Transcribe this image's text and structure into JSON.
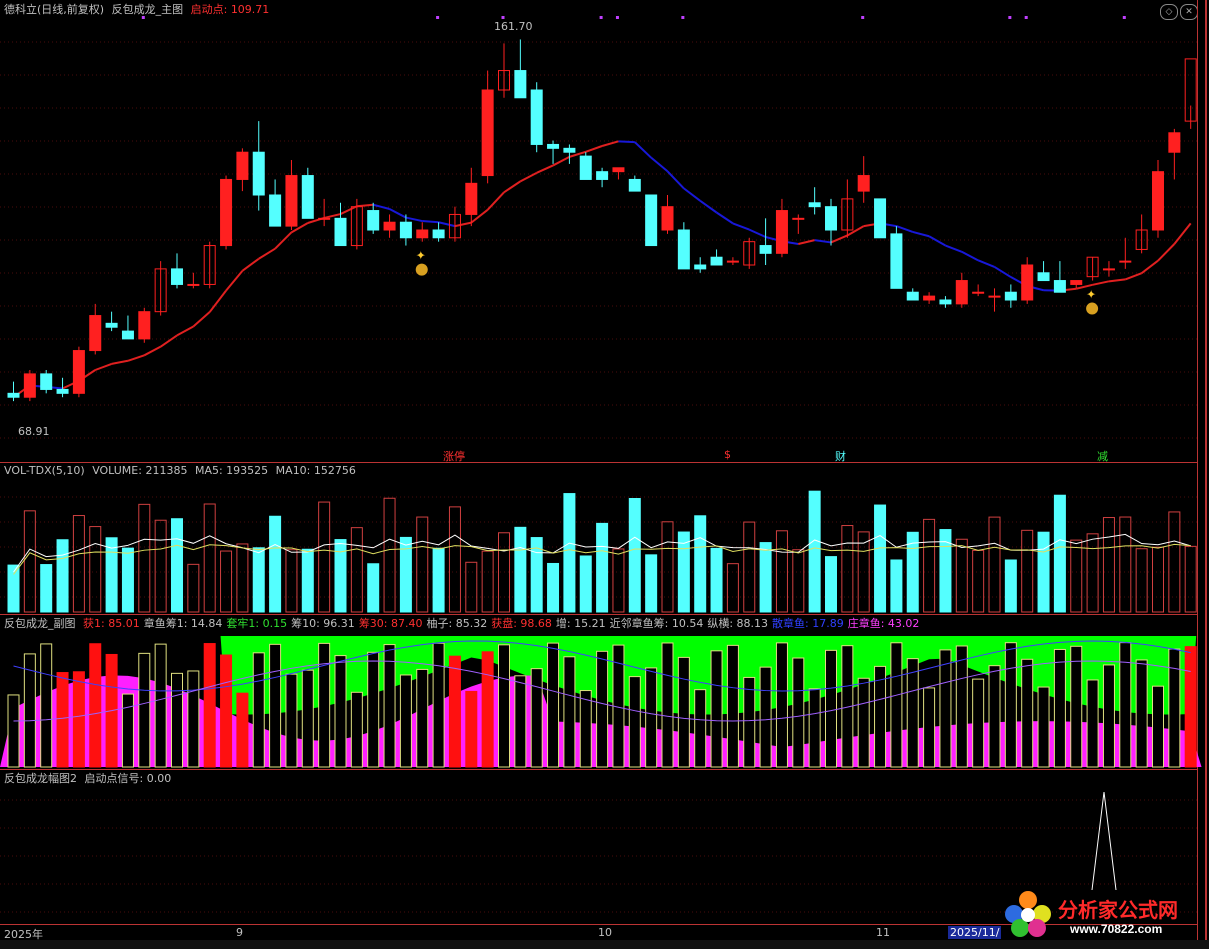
{
  "main": {
    "symbol": "德科立(日线,前复权)",
    "indicator": "反包成龙_主图",
    "start_label": "启动点:",
    "start_value": "109.71",
    "high_label": "161.70",
    "low_label": "68.91",
    "markers": [
      "涨停",
      "$",
      "财",
      "减"
    ]
  },
  "vol": {
    "title": "VOL-TDX(5,10)",
    "volume": "VOLUME: 211385",
    "ma5": "MA5: 193525",
    "ma10": "MA10: 152756"
  },
  "sub": {
    "title": "反包成龙_副图",
    "items": [
      {
        "t": "获1: 85.01",
        "c": "#ff3030"
      },
      {
        "t": "章鱼筹1: 14.84",
        "c": "#c0c0c0"
      },
      {
        "t": "套牢1: 0.15",
        "c": "#30e030"
      },
      {
        "t": "筹10: 96.31",
        "c": "#c0c0c0"
      },
      {
        "t": "筹30: 87.40",
        "c": "#ff3030"
      },
      {
        "t": "柚子: 85.32",
        "c": "#c0c0c0"
      },
      {
        "t": "获盘: 98.68",
        "c": "#ff3030"
      },
      {
        "t": "增: 15.21",
        "c": "#c0c0c0"
      },
      {
        "t": "近邻章鱼筹: 10.54",
        "c": "#c0c0c0"
      },
      {
        "t": "纵横: 88.13",
        "c": "#c0c0c0"
      },
      {
        "t": "散章鱼: 17.89",
        "c": "#3040ff"
      },
      {
        "t": "庄章鱼: 43.02",
        "c": "#ff40ff"
      }
    ]
  },
  "sub2": {
    "title": "反包成龙幅图2",
    "signal": "启动点信号: 0.00"
  },
  "xaxis": [
    "2025年",
    "9",
    "10",
    "11",
    "2025/11/"
  ],
  "logo": {
    "text": "分析家公式网",
    "url": "www.70822.com"
  },
  "colors": {
    "up": "#ff2020",
    "down": "#54ffff",
    "ma_up": "#e02020",
    "ma_down": "#1818d8",
    "frame": "#b33333"
  },
  "chart_data": {
    "type": "candlestick",
    "price_range": [
      68.91,
      161.7
    ],
    "candles": [
      [
        72,
        75,
        70,
        71
      ],
      [
        71,
        78,
        70,
        77
      ],
      [
        77,
        78,
        72,
        73
      ],
      [
        73,
        76,
        71,
        72
      ],
      [
        72,
        84,
        71,
        83
      ],
      [
        83,
        95,
        82,
        92
      ],
      [
        90,
        93,
        88,
        89
      ],
      [
        88,
        92,
        86,
        86
      ],
      [
        86,
        94,
        85,
        93
      ],
      [
        93,
        106,
        92,
        104
      ],
      [
        104,
        108,
        99,
        100
      ],
      [
        100,
        103,
        99,
        100
      ],
      [
        100,
        111,
        99,
        110
      ],
      [
        110,
        128,
        109,
        127
      ],
      [
        127,
        135,
        124,
        134
      ],
      [
        134,
        142,
        119,
        123
      ],
      [
        123,
        127,
        115,
        115
      ],
      [
        115,
        132,
        114,
        128
      ],
      [
        128,
        130,
        118,
        117
      ],
      [
        117,
        122,
        115,
        117
      ],
      [
        117,
        121,
        110,
        110
      ],
      [
        110,
        122,
        109,
        120
      ],
      [
        119,
        121,
        113,
        114
      ],
      [
        114,
        118,
        112,
        116
      ],
      [
        116,
        118,
        110,
        112
      ],
      [
        112,
        116,
        111,
        114
      ],
      [
        114,
        116,
        111,
        112
      ],
      [
        112,
        120,
        111,
        118
      ],
      [
        118,
        130,
        115,
        126
      ],
      [
        128,
        155,
        126,
        150
      ],
      [
        150,
        162,
        148,
        155
      ],
      [
        155,
        163,
        151,
        148
      ],
      [
        150,
        152,
        134,
        136
      ],
      [
        136,
        137,
        131,
        135
      ],
      [
        135,
        136,
        131,
        134
      ],
      [
        133,
        134,
        128,
        127
      ],
      [
        129,
        130,
        125,
        127
      ],
      [
        129,
        130,
        127,
        130
      ],
      [
        127,
        128,
        124,
        124
      ],
      [
        123,
        123,
        110,
        110
      ],
      [
        114,
        123,
        113,
        120
      ],
      [
        114,
        116,
        104,
        104
      ],
      [
        105,
        107,
        103,
        104
      ],
      [
        107,
        109,
        105,
        105
      ],
      [
        106,
        107,
        105,
        106
      ],
      [
        105,
        112,
        104,
        111
      ],
      [
        110,
        117,
        105,
        108
      ],
      [
        108,
        122,
        107,
        119
      ],
      [
        117,
        118,
        113,
        117
      ],
      [
        121,
        125,
        118,
        120
      ],
      [
        120,
        122,
        110,
        114
      ],
      [
        114,
        127,
        112,
        122
      ],
      [
        124,
        133,
        121,
        128
      ],
      [
        122,
        122,
        112,
        112
      ],
      [
        113,
        115,
        99,
        99
      ],
      [
        98,
        99,
        96,
        96
      ],
      [
        96,
        98,
        95,
        97
      ],
      [
        96,
        97,
        94,
        95
      ],
      [
        95,
        103,
        94,
        101
      ],
      [
        98,
        100,
        97,
        98
      ],
      [
        97,
        99,
        93,
        97
      ],
      [
        98,
        100,
        94,
        96
      ],
      [
        96,
        107,
        95,
        105
      ],
      [
        103,
        106,
        101,
        101
      ],
      [
        101,
        106,
        98,
        98
      ],
      [
        100,
        101,
        99,
        101
      ],
      [
        102,
        107,
        101,
        107
      ],
      [
        104,
        106,
        102,
        104
      ],
      [
        106,
        112,
        104,
        106
      ],
      [
        109,
        118,
        108,
        114
      ],
      [
        114,
        132,
        112,
        129
      ],
      [
        134,
        140,
        127,
        139
      ],
      [
        142,
        146,
        140,
        158
      ]
    ]
  }
}
